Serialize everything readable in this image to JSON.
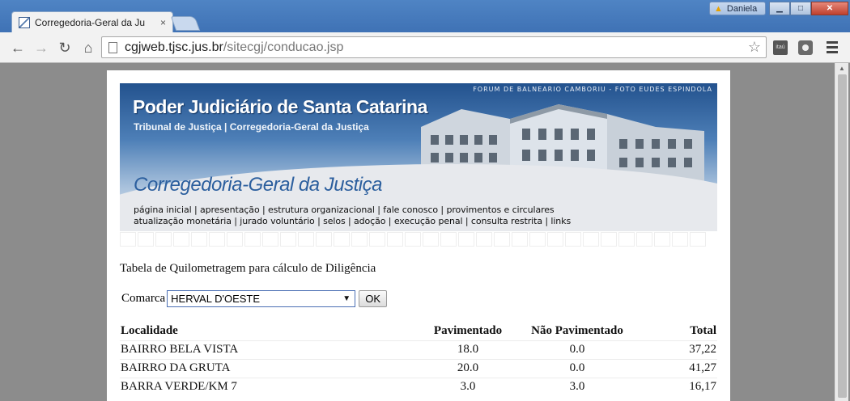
{
  "browser": {
    "tab_title": "Corregedoria-Geral da Ju",
    "tab_close": "×",
    "profile_name": "Daniela",
    "url_host": "cgjweb.tjsc.jus.br",
    "url_path": "/sitecgj/conducao.jsp",
    "extension_itau": "itaú"
  },
  "banner": {
    "photo_credit": "FORUM DE BALNEARIO CAMBORIU - FOTO EUDES ESPINDOLA",
    "title": "Poder Judiciário de Santa Catarina",
    "subtitle": "Tribunal de Justiça  |  Corregedoria-Geral da Justiça",
    "section": "Corregedoria-Geral da Justiça",
    "links_row1": [
      "página inicial",
      "apresentação",
      "estrutura organizacional",
      "fale conosco",
      "provimentos e circulares"
    ],
    "links_row2": [
      "atualização monetária",
      "jurado voluntário",
      "selos",
      "adoção",
      "execução penal",
      "consulta restrita",
      "links"
    ]
  },
  "main": {
    "heading": "Tabela de Quilometragem para cálculo de Diligência",
    "comarca_label": "Comarca",
    "comarca_selected": "HERVAL D'OESTE",
    "ok_label": "OK"
  },
  "table": {
    "headers": [
      "Localidade",
      "Pavimentado",
      "Não Pavimentado",
      "Total"
    ],
    "rows": [
      [
        "BAIRRO BELA VISTA",
        "18.0",
        "0.0",
        "37,22"
      ],
      [
        "BAIRRO DA GRUTA",
        "20.0",
        "0.0",
        "41,27"
      ],
      [
        "BARRA VERDE/KM 7",
        "3.0",
        "3.0",
        "16,17"
      ]
    ]
  },
  "colors": {
    "accent": "#2c5f9e",
    "chrome_frame": "#3f72b5"
  }
}
